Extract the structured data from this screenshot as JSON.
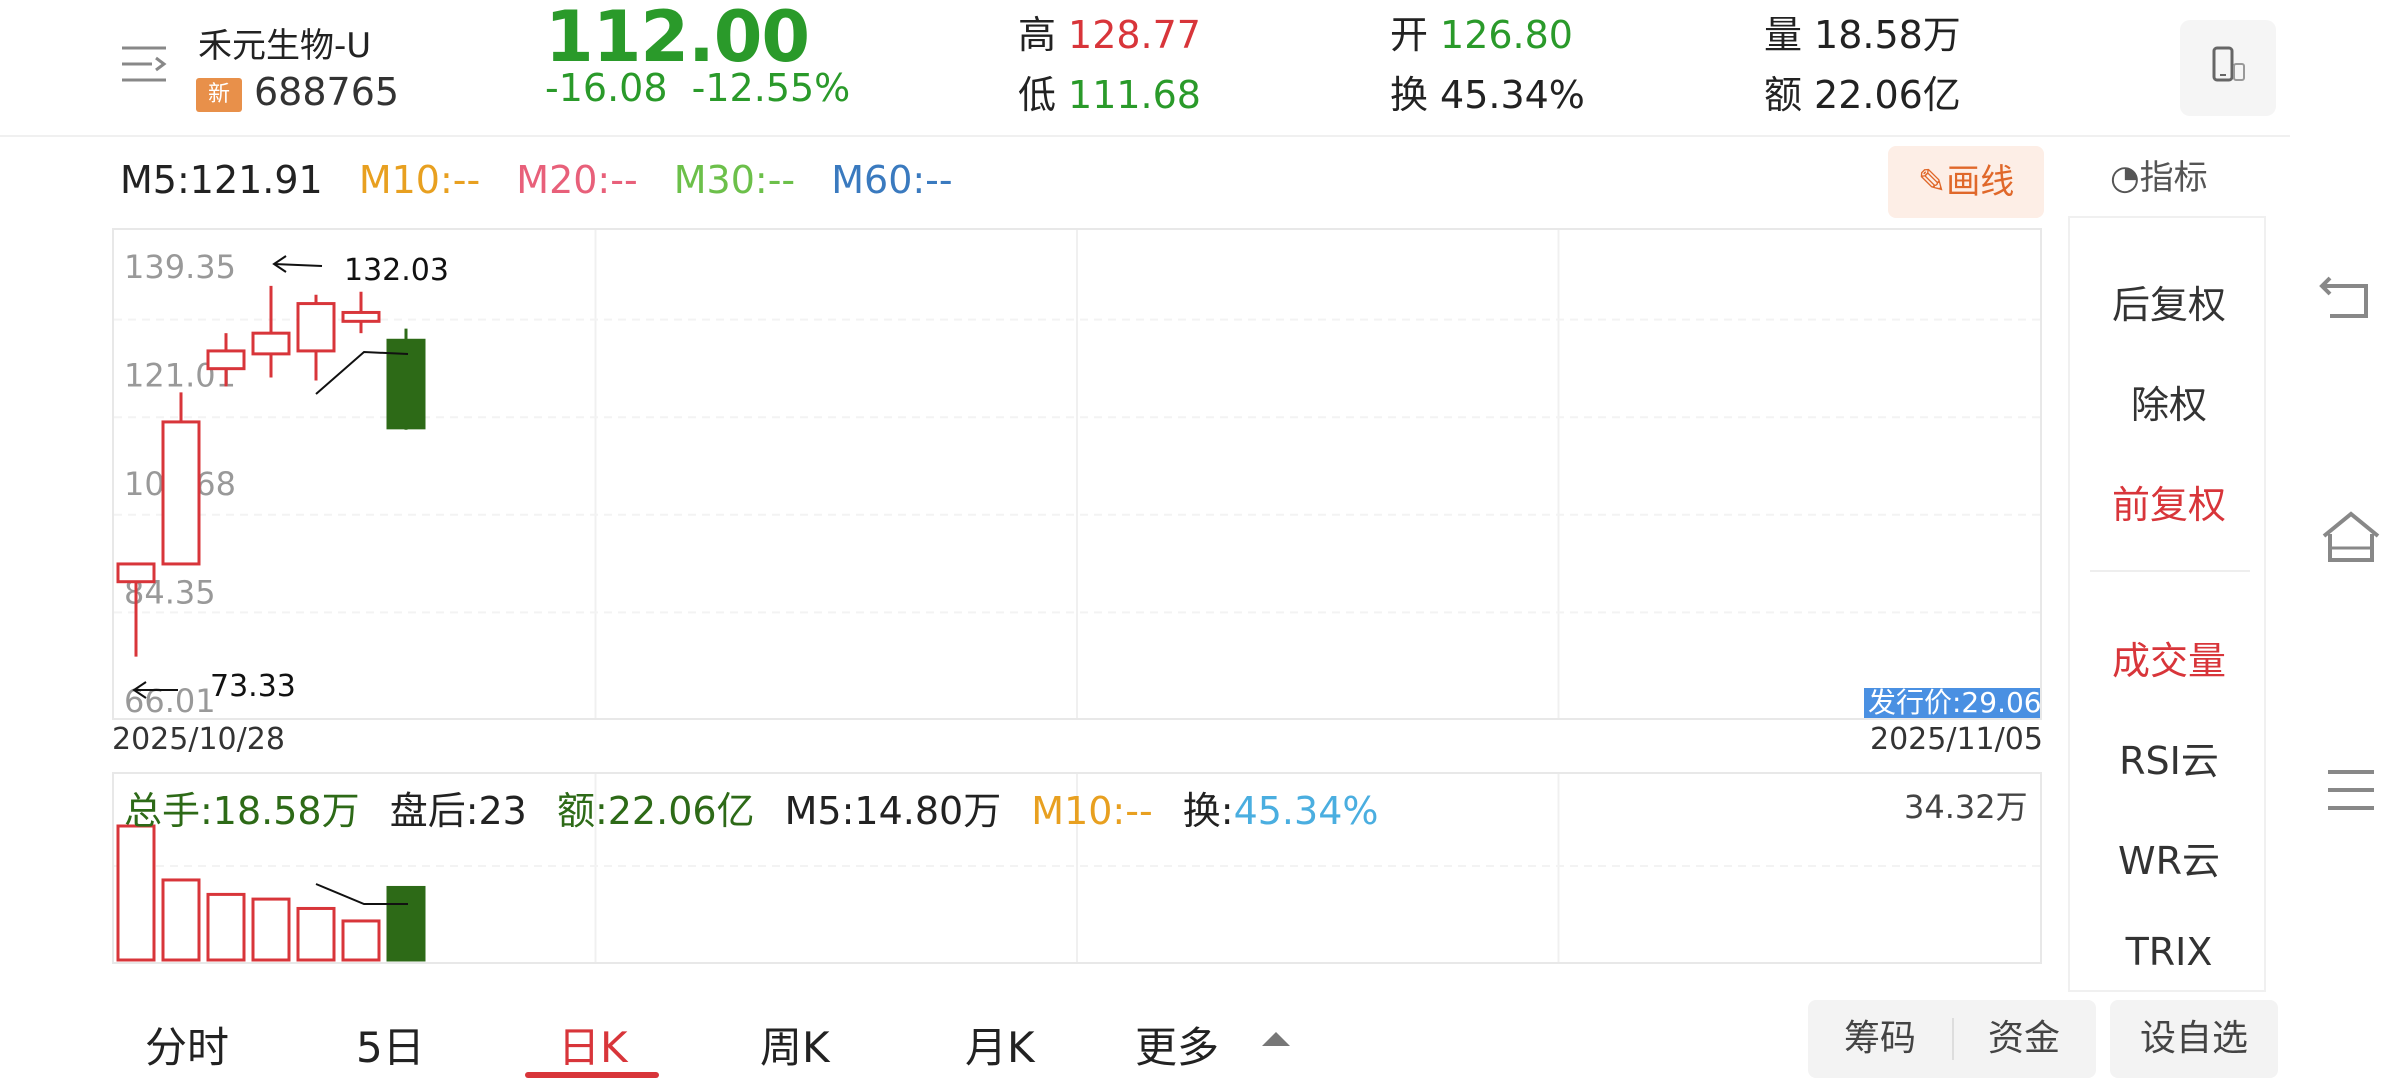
{
  "header": {
    "stock_name": "禾元生物-U",
    "badge": "新",
    "code": "688765",
    "price": "112.00",
    "change": "-16.08",
    "change_pct": "-12.55%",
    "high_label": "高",
    "high": "128.77",
    "low_label": "低",
    "low": "111.68",
    "open_label": "开",
    "open": "126.80",
    "turnover_label": "换",
    "turnover": "45.34%",
    "volume_label": "量",
    "volume": "18.58万",
    "amount_label": "额",
    "amount": "22.06亿"
  },
  "ma": {
    "m5": "M5:121.91",
    "m10": "M10:--",
    "m20": "M20:--",
    "m30": "M30:--",
    "m60": "M60:--"
  },
  "toolbar": {
    "draw_label": "画线",
    "indicator_label": "指标"
  },
  "colors": {
    "up": "#d8353a",
    "down": "#2a9a2a",
    "down_fill": "#2d6a17",
    "m5": "#222222",
    "m10": "#e8a020",
    "m20": "#e8607a",
    "m30": "#6cc04a",
    "m60": "#3a7abf",
    "issue_price_bg": "#4a90e2"
  },
  "chart_data": {
    "type": "candlestick",
    "y_ticks": [
      "139.35",
      "121.01",
      "102.68",
      "84.35",
      "66.01"
    ],
    "ylim": [
      66.01,
      139.35
    ],
    "date_start": "2025/10/28",
    "date_end": "2025/11/05",
    "candles": [
      {
        "open": 86.0,
        "close": 89.0,
        "high": 89.0,
        "low": 73.33
      },
      {
        "open": 89.0,
        "close": 113.0,
        "high": 118.0,
        "low": 89.0
      },
      {
        "open": 122.0,
        "close": 125.0,
        "high": 128.0,
        "low": 119.0
      },
      {
        "open": 124.5,
        "close": 128.0,
        "high": 136.0,
        "low": 120.5
      },
      {
        "open": 125.0,
        "close": 133.0,
        "high": 134.5,
        "low": 120.0
      },
      {
        "open": 130.0,
        "close": 131.5,
        "high": 135.0,
        "low": 128.0
      },
      {
        "open": 126.8,
        "close": 112.0,
        "high": 128.77,
        "low": 111.68
      }
    ],
    "max_label": "132.03",
    "min_label": "73.33",
    "issue_price_label": "发行价:29.06",
    "volume_max_label": "34.32万",
    "volumes": [
      34.32,
      20.5,
      16.8,
      15.6,
      13.2,
      10.0,
      18.58
    ]
  },
  "volume_stats": {
    "total": "总手:18.58万",
    "after_hours": "盘后:23",
    "amount": "额:22.06亿",
    "m5": "M5:14.80万",
    "m10": "M10:--",
    "turnover_label": "换:",
    "turnover": "45.34%"
  },
  "side_panel": {
    "items": [
      "后复权",
      "除权",
      "前复权",
      "成交量",
      "RSI云",
      "WR云",
      "TRIX"
    ]
  },
  "tabs": [
    "分时",
    "5日",
    "日K",
    "周K",
    "月K",
    "更多"
  ],
  "bottom_buttons": {
    "chips": "筹码",
    "funds": "资金",
    "watchlist": "设自选"
  }
}
